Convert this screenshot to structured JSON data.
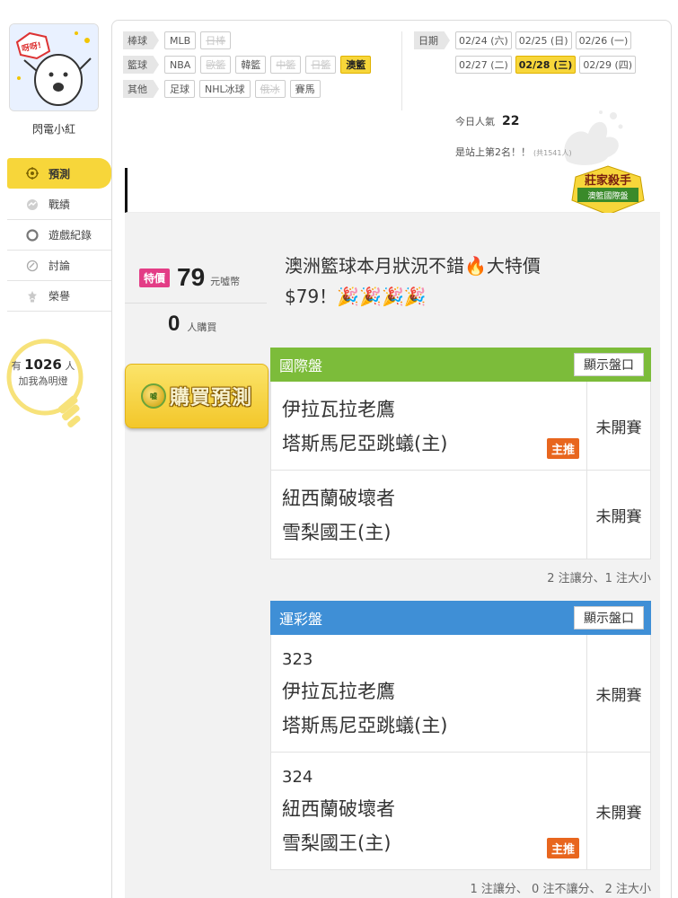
{
  "user": {
    "name": "閃電小紅",
    "avatar_speech": "呀呀!"
  },
  "sidebar": {
    "items": [
      {
        "label": "預測",
        "icon": "target-icon"
      },
      {
        "label": "戰績",
        "icon": "record-icon"
      },
      {
        "label": "遊戲紀錄",
        "icon": "circle-icon"
      },
      {
        "label": "討論",
        "icon": "chat-icon"
      },
      {
        "label": "榮譽",
        "icon": "medal-icon"
      }
    ],
    "active_index": 0
  },
  "followers": {
    "prefix": "有",
    "count": "1026",
    "suffix": "人",
    "cta": "加我為明燈"
  },
  "sports": {
    "rows": [
      {
        "category": "棒球",
        "tags": [
          {
            "label": "MLB",
            "state": "normal"
          },
          {
            "label": "日棒",
            "state": "off"
          }
        ]
      },
      {
        "category": "籃球",
        "tags": [
          {
            "label": "NBA",
            "state": "normal"
          },
          {
            "label": "歐籃",
            "state": "off"
          },
          {
            "label": "韓籃",
            "state": "normal"
          },
          {
            "label": "中籃",
            "state": "off"
          },
          {
            "label": "日籃",
            "state": "off"
          },
          {
            "label": "澳籃",
            "state": "selected"
          }
        ]
      },
      {
        "category": "其他",
        "tags": [
          {
            "label": "足球",
            "state": "normal"
          },
          {
            "label": "NHL冰球",
            "state": "normal"
          },
          {
            "label": "俄冰",
            "state": "off"
          },
          {
            "label": "賽馬",
            "state": "normal"
          }
        ]
      }
    ]
  },
  "dates": {
    "label": "日期",
    "row1": [
      {
        "label": "02/24 (六)",
        "selected": false
      },
      {
        "label": "02/25 (日)",
        "selected": false
      },
      {
        "label": "02/26 (一)",
        "selected": false
      }
    ],
    "row2": [
      {
        "label": "02/27 (二)",
        "selected": false
      },
      {
        "label": "02/28 (三)",
        "selected": true
      },
      {
        "label": "02/29 (四)",
        "selected": false
      }
    ]
  },
  "popularity": {
    "today_label": "今日人氣",
    "today_value": "22",
    "rank_text": "是站上第2名！！",
    "total_text": "(共1541人)"
  },
  "badge": {
    "title": "莊家殺手",
    "subtitle": "澳籃國際盤"
  },
  "offer": {
    "special_label": "特價",
    "price": "79",
    "unit": "元噓幣",
    "buyers": "0",
    "buyers_label": "人購買",
    "buy_button": "購買預測"
  },
  "headline": {
    "line1": "澳洲籃球本月狀況不錯🔥大特價",
    "line2": "$79！🎉🎉🎉🎉"
  },
  "panels": {
    "intl": {
      "title": "國際盤",
      "show_button": "顯示盤口",
      "matches": [
        {
          "away": "伊拉瓦拉老鷹",
          "home": "塔斯馬尼亞跳蟻(主)",
          "status": "未開賽",
          "recommend": "主推"
        },
        {
          "away": "紐西蘭破壞者",
          "home": "雪梨國王(主)",
          "status": "未開賽",
          "recommend": ""
        }
      ],
      "summary": "2 注讓分、1 注大小"
    },
    "sports_lottery": {
      "title": "運彩盤",
      "show_button": "顯示盤口",
      "matches": [
        {
          "number": "323",
          "away": "伊拉瓦拉老鷹",
          "home": "塔斯馬尼亞跳蟻(主)",
          "status": "未開賽",
          "recommend": ""
        },
        {
          "number": "324",
          "away": "紐西蘭破壞者",
          "home": "雪梨國王(主)",
          "status": "未開賽",
          "recommend": "主推"
        }
      ],
      "summary": "1 注讓分、 0 注不讓分、 2 注大小"
    }
  },
  "colors": {
    "accent_yellow": "#f7d63a",
    "special_pink": "#e33d86",
    "intl_green": "#7cbc3a",
    "lottery_blue": "#3f8fd6",
    "recommend_orange": "#e8661e"
  }
}
